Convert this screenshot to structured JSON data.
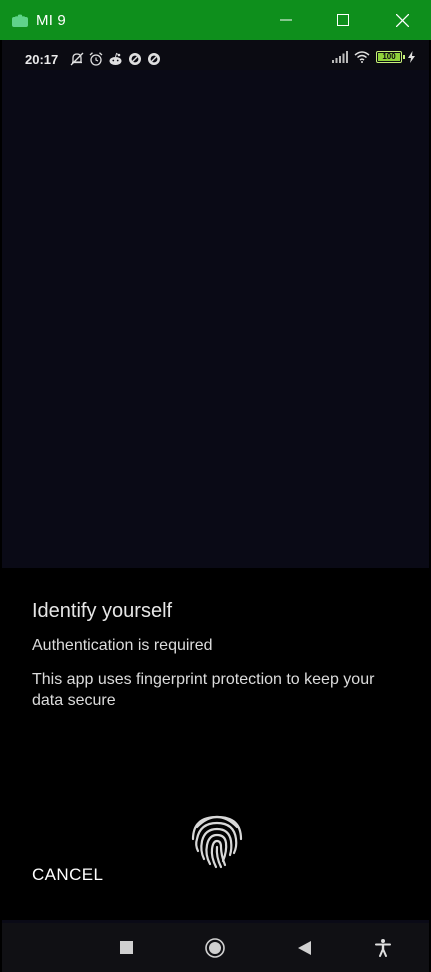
{
  "window": {
    "title": "MI 9",
    "buttons": [
      "minimize-icon",
      "maximize-icon",
      "close-icon"
    ],
    "accent": "#0e8f1c"
  },
  "statusbar": {
    "time": "20:17",
    "left_icons": [
      "bell-off-icon",
      "alarm-icon",
      "reddit-icon",
      "app-icon",
      "app-icon"
    ],
    "right_icons": [
      "signal-icon",
      "wifi-icon",
      "battery-icon",
      "charging-icon"
    ],
    "battery_level": 100,
    "battery_text": "100"
  },
  "dialog": {
    "title": "Identify yourself",
    "subtitle": "Authentication is required",
    "description": "This app uses fingerprint protection to keep your data secure",
    "cancel_label": "CANCEL",
    "icon": "fingerprint-icon"
  },
  "navbar": {
    "buttons": [
      "recents-icon",
      "home-icon",
      "back-icon",
      "accessibility-icon"
    ]
  }
}
